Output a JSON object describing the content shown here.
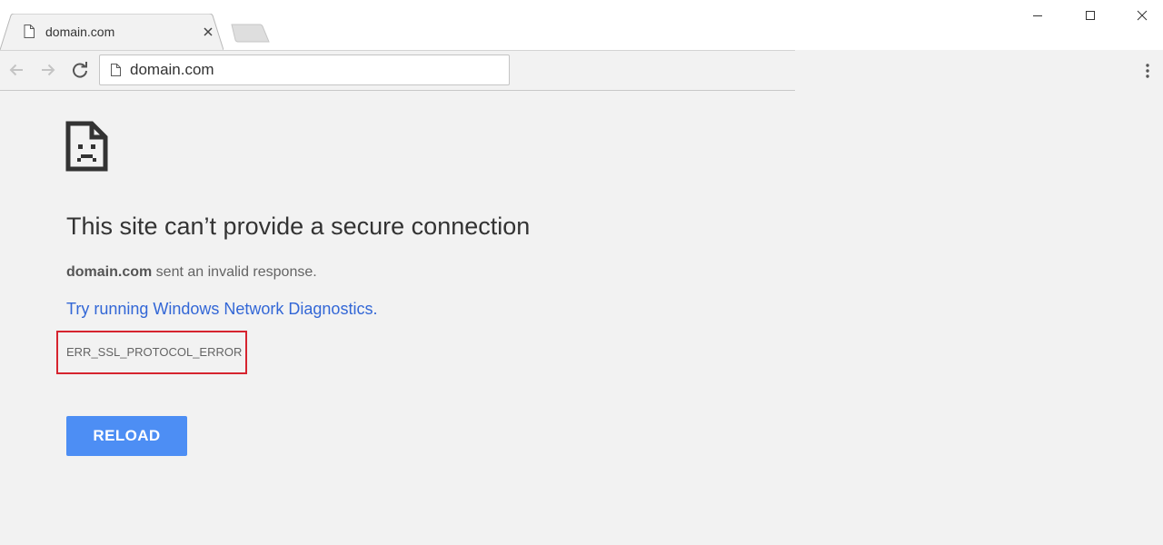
{
  "tab": {
    "title": "domain.com",
    "icon": "document-icon"
  },
  "window_controls": [
    "minimize-icon",
    "maximize-icon",
    "close-icon"
  ],
  "toolbar": {
    "url": "domain.com",
    "icons": [
      "back-arrow-icon",
      "forward-arrow-icon",
      "reload-icon",
      "page-info-icon",
      "menu-kebab-icon"
    ]
  },
  "error": {
    "icon": "sad-page-icon",
    "heading": "This site can’t provide a secure connection",
    "host": "domain.com",
    "summary_rest": " sent an invalid response.",
    "diagnostics_link": "Try running Windows Network Diagnostics.",
    "code": "ERR_SSL_PROTOCOL_ERROR",
    "reload_label": "RELOAD"
  },
  "colors": {
    "page_background": "#f2f2f2",
    "link": "#3367d6",
    "reload_button": "#4d8ef4",
    "highlight_box": "#d6242f"
  }
}
